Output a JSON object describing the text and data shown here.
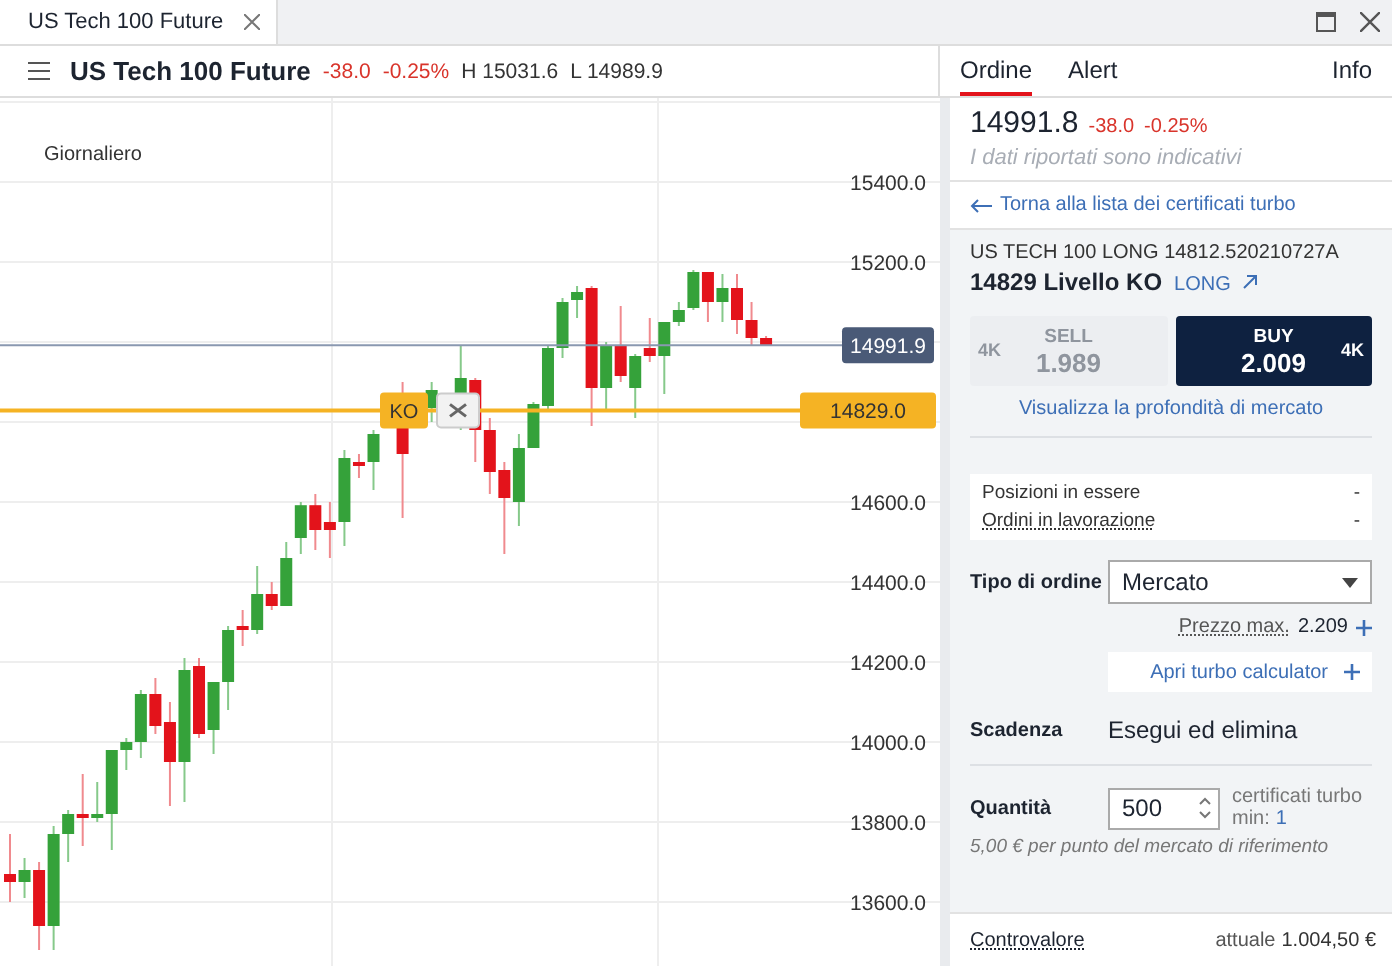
{
  "tab": {
    "title": "US Tech 100 Future"
  },
  "header": {
    "symbol": "US Tech 100 Future",
    "change": "-38.0",
    "change_pct": "-0.25%",
    "high": "H 15031.6",
    "low": "L 14989.9"
  },
  "chart": {
    "period": "Giornaliero",
    "price_marker": "14991.9",
    "ko_tag": "KO",
    "ko_price": "14829.0",
    "chart_data": {
      "type": "candlestick",
      "grid": true,
      "ylim": [
        13435,
        15610
      ],
      "ohlc": [
        [
          13670,
          13770,
          13600,
          13650
        ],
        [
          13650,
          13710,
          13610,
          13680
        ],
        [
          13680,
          13700,
          13480,
          13540
        ],
        [
          13540,
          13790,
          13480,
          13770
        ],
        [
          13770,
          13830,
          13700,
          13820
        ],
        [
          13820,
          13920,
          13740,
          13810
        ],
        [
          13810,
          13900,
          13800,
          13820
        ],
        [
          13820,
          13980,
          13730,
          13980
        ],
        [
          13980,
          14010,
          13930,
          14000
        ],
        [
          14000,
          14130,
          13960,
          14120
        ],
        [
          14120,
          14160,
          14020,
          14040
        ],
        [
          14050,
          14100,
          13840,
          13950
        ],
        [
          13950,
          14210,
          13850,
          14180
        ],
        [
          14190,
          14210,
          14010,
          14020
        ],
        [
          14030,
          14150,
          13970,
          14150
        ],
        [
          14150,
          14290,
          14080,
          14280
        ],
        [
          14290,
          14330,
          14240,
          14280
        ],
        [
          14280,
          14440,
          14270,
          14370
        ],
        [
          14370,
          14400,
          14330,
          14340
        ],
        [
          14340,
          14500,
          14340,
          14460
        ],
        [
          14510,
          14600,
          14470,
          14592
        ],
        [
          14592,
          14620,
          14480,
          14530
        ],
        [
          14550,
          14600,
          14460,
          14530
        ],
        [
          14550,
          14730,
          14490,
          14710
        ],
        [
          14700,
          14720,
          14660,
          14690
        ],
        [
          14700,
          14780,
          14630,
          14770
        ],
        null,
        [
          14785,
          14900,
          14560,
          14720
        ],
        null,
        [
          14835,
          14900,
          14800,
          14880
        ],
        null,
        [
          14870,
          14990,
          14780,
          14910
        ],
        [
          14905,
          14910,
          14700,
          14780
        ],
        [
          14780,
          14810,
          14620,
          14675
        ],
        [
          14680,
          14700,
          14470,
          14610
        ],
        [
          14600,
          14770,
          14540,
          14735
        ],
        [
          14735,
          14850,
          14735,
          14845
        ],
        [
          14840,
          14990,
          14830,
          14985
        ],
        [
          14985,
          15110,
          14960,
          15100
        ],
        [
          15105,
          15140,
          15060,
          15125
        ],
        [
          15135,
          15140,
          14790,
          14885
        ],
        [
          14885,
          15000,
          14830,
          14990
        ],
        [
          14990,
          15090,
          14900,
          14915
        ],
        [
          14885,
          14970,
          14810,
          14965
        ],
        [
          14985,
          15060,
          14950,
          14965
        ],
        [
          14965,
          15050,
          14870,
          15050
        ],
        [
          15050,
          15100,
          15040,
          15080
        ],
        [
          15085,
          15180,
          15080,
          15175
        ],
        [
          15175,
          15175,
          15050,
          15100
        ],
        [
          15100,
          15170,
          15050,
          15135
        ],
        [
          15135,
          15170,
          15020,
          15055
        ],
        [
          15055,
          15100,
          14990,
          15010
        ],
        [
          15010,
          15015,
          14990,
          14990
        ]
      ],
      "yticks": [
        {
          "value": 15400,
          "label": "15400.0"
        },
        {
          "value": 15200,
          "label": "15200.0"
        },
        {
          "value": 14600,
          "label": "14600.0"
        },
        {
          "value": 14400,
          "label": "14400.0"
        },
        {
          "value": 14200,
          "label": "14200.0"
        },
        {
          "value": 14000,
          "label": "14000.0"
        },
        {
          "value": 13800,
          "label": "13800.0"
        },
        {
          "value": 13600,
          "label": "13600.0"
        }
      ]
    }
  },
  "panel_tabs": [
    {
      "label": "Ordine",
      "selected": true
    },
    {
      "label": "Alert",
      "selected": false
    },
    {
      "label": "Info",
      "selected": false
    }
  ],
  "quote": {
    "price": "14991.8",
    "change": "-38.0",
    "change_pct": "-0.25%",
    "note": "I dati riportati sono indicativi"
  },
  "back_link": "Torna alla lista dei certificati turbo",
  "product": {
    "name": "US TECH 100 LONG 14812.520210727A",
    "ko_level": "14829 Livello KO",
    "direction": "LONG"
  },
  "sides": [
    {
      "size": "4K",
      "label": "SELL",
      "price": "1.989",
      "selected": false
    },
    {
      "size": "4K",
      "label": "BUY",
      "price": "2.009",
      "selected": true
    }
  ],
  "depth_link": "Visualizza la profondità di mercato",
  "positions": [
    {
      "label": "Posizioni in essere",
      "value": "-",
      "underlined": false
    },
    {
      "label": "Ordini in lavorazione",
      "value": "-",
      "underlined": true
    }
  ],
  "order_type": {
    "label": "Tipo di ordine",
    "value": "Mercato"
  },
  "max_price": {
    "label": "Prezzo max.",
    "value": "2.209"
  },
  "calculator_link": "Apri turbo calculator",
  "expiry": {
    "label": "Scadenza",
    "value": "Esegui ed elimina"
  },
  "quantity": {
    "label": "Quantità",
    "value": "500",
    "unit": "certificati turbo",
    "min_label": "min:",
    "min": "1",
    "note": "5,00 € per punto del mercato di riferimento"
  },
  "total": {
    "label": "Controvalore",
    "prefix": "attuale",
    "value": "1.004,50 €"
  }
}
